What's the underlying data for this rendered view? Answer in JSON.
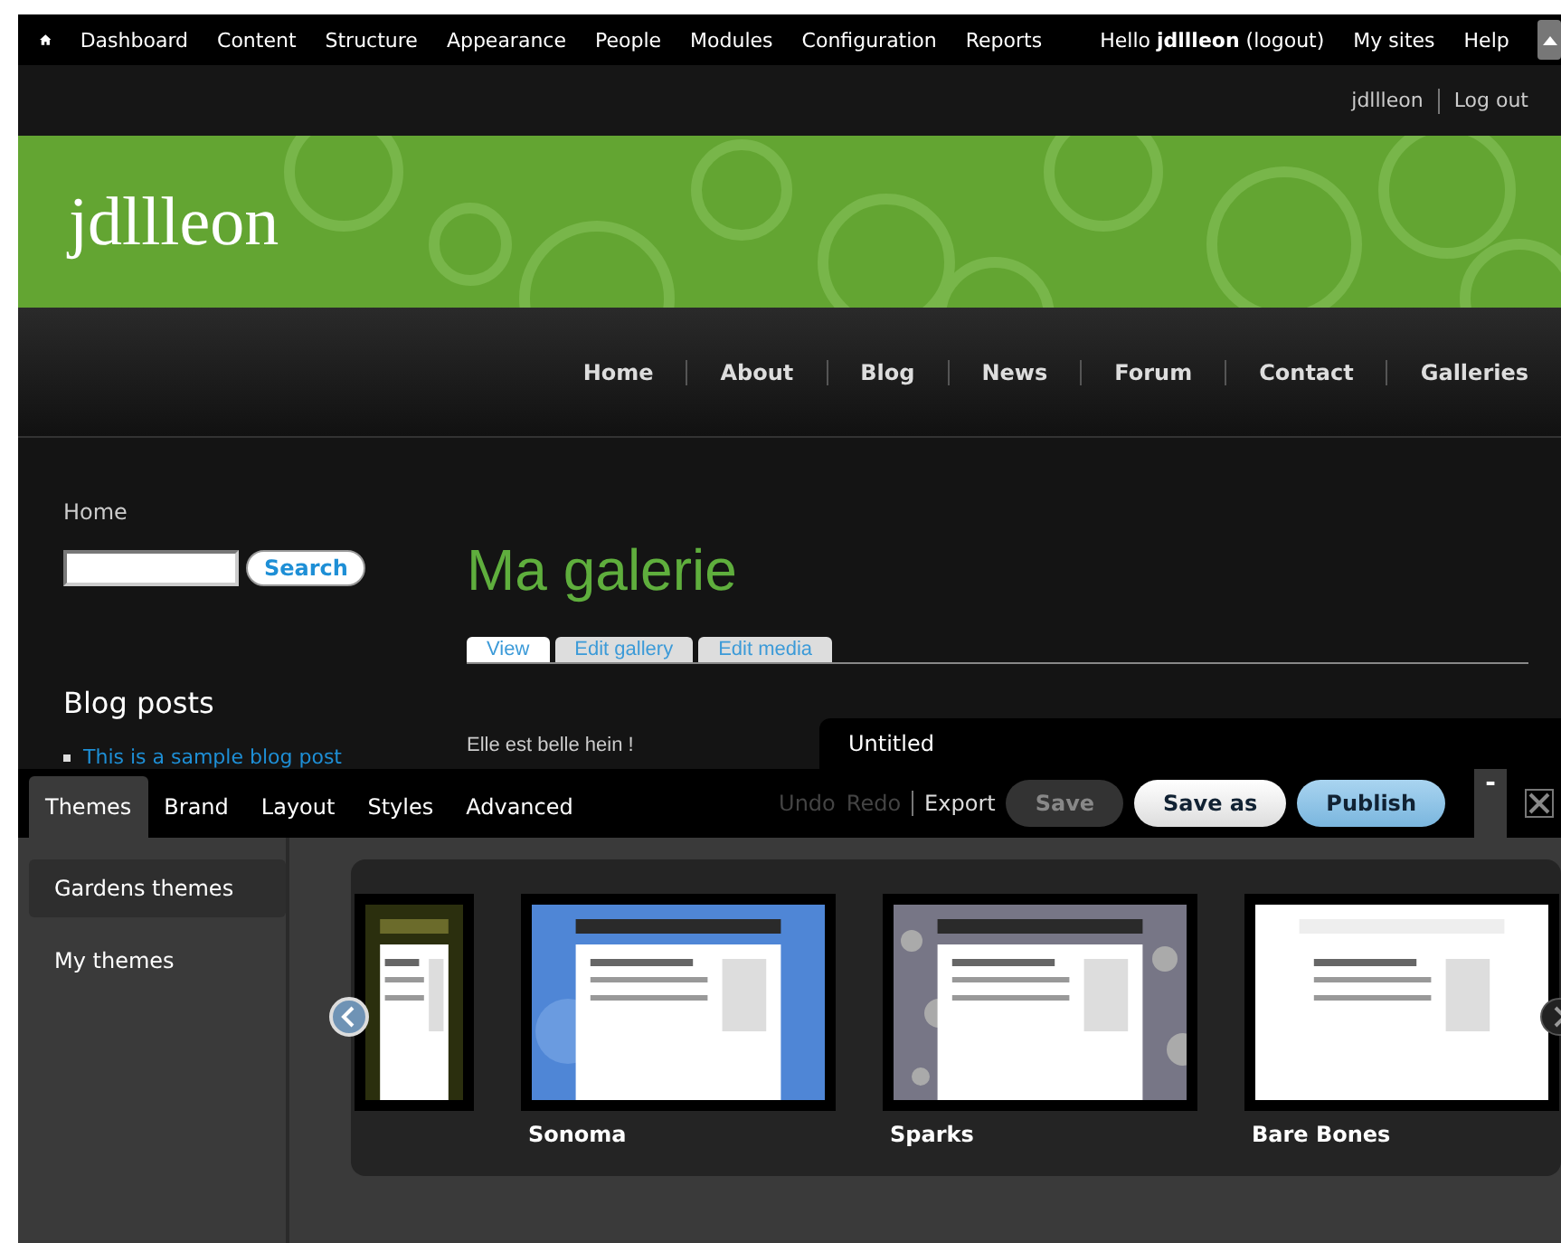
{
  "admin_menu": {
    "items": [
      "Dashboard",
      "Content",
      "Structure",
      "Appearance",
      "People",
      "Modules",
      "Configuration",
      "Reports"
    ],
    "greeting": "Hello **jdllleon** (logout)",
    "links": [
      "My sites",
      "Help"
    ]
  },
  "user_bar": {
    "links": [
      "jdllleon",
      "Log out"
    ]
  },
  "site_name": "jdllleon",
  "main_nav": [
    {
      "label": "Home"
    },
    {
      "label": "About"
    },
    {
      "label": "Blog"
    },
    {
      "label": "News"
    },
    {
      "label": "Forum"
    },
    {
      "label": "Contact"
    },
    {
      "label": "Galleries"
    }
  ],
  "breadcrumb": "Home",
  "search": {
    "button": "Search"
  },
  "blog_block": {
    "title": "Blog posts",
    "items": [
      "This is a sample blog post"
    ]
  },
  "page": {
    "title": "Ma galerie",
    "tabs": [
      {
        "label": "View",
        "selected": true
      },
      {
        "label": "Edit gallery",
        "selected": false
      },
      {
        "label": "Edit media",
        "selected": false
      }
    ],
    "body": "Elle est belle hein !"
  },
  "theme_name_tab": "Untitled",
  "themebuilder": {
    "tabs": [
      {
        "label": "Themes",
        "selected": true
      },
      {
        "label": "Brand",
        "selected": false
      },
      {
        "label": "Layout",
        "selected": false
      },
      {
        "label": "Styles",
        "selected": false
      },
      {
        "label": "Advanced",
        "selected": false
      }
    ],
    "actions": [
      {
        "label": "Undo",
        "kind": "link",
        "disabled": true
      },
      {
        "label": "Redo",
        "kind": "link",
        "disabled": true
      },
      {
        "label": "Export",
        "kind": "link",
        "disabled": false
      },
      {
        "label": "Save",
        "kind": "dark",
        "disabled": true
      },
      {
        "label": "Save as",
        "kind": "light",
        "disabled": false
      },
      {
        "label": "Publish",
        "kind": "primary",
        "disabled": false
      }
    ],
    "minimize": "-",
    "sidebar": [
      {
        "label": "Gardens themes",
        "selected": true
      },
      {
        "label": "My themes",
        "selected": false
      }
    ],
    "themes": [
      {
        "kind": "partial"
      },
      {
        "kind": "full",
        "name": "Sonoma"
      },
      {
        "kind": "full",
        "name": "Sparks"
      },
      {
        "kind": "full",
        "name": "Bare Bones"
      }
    ]
  }
}
